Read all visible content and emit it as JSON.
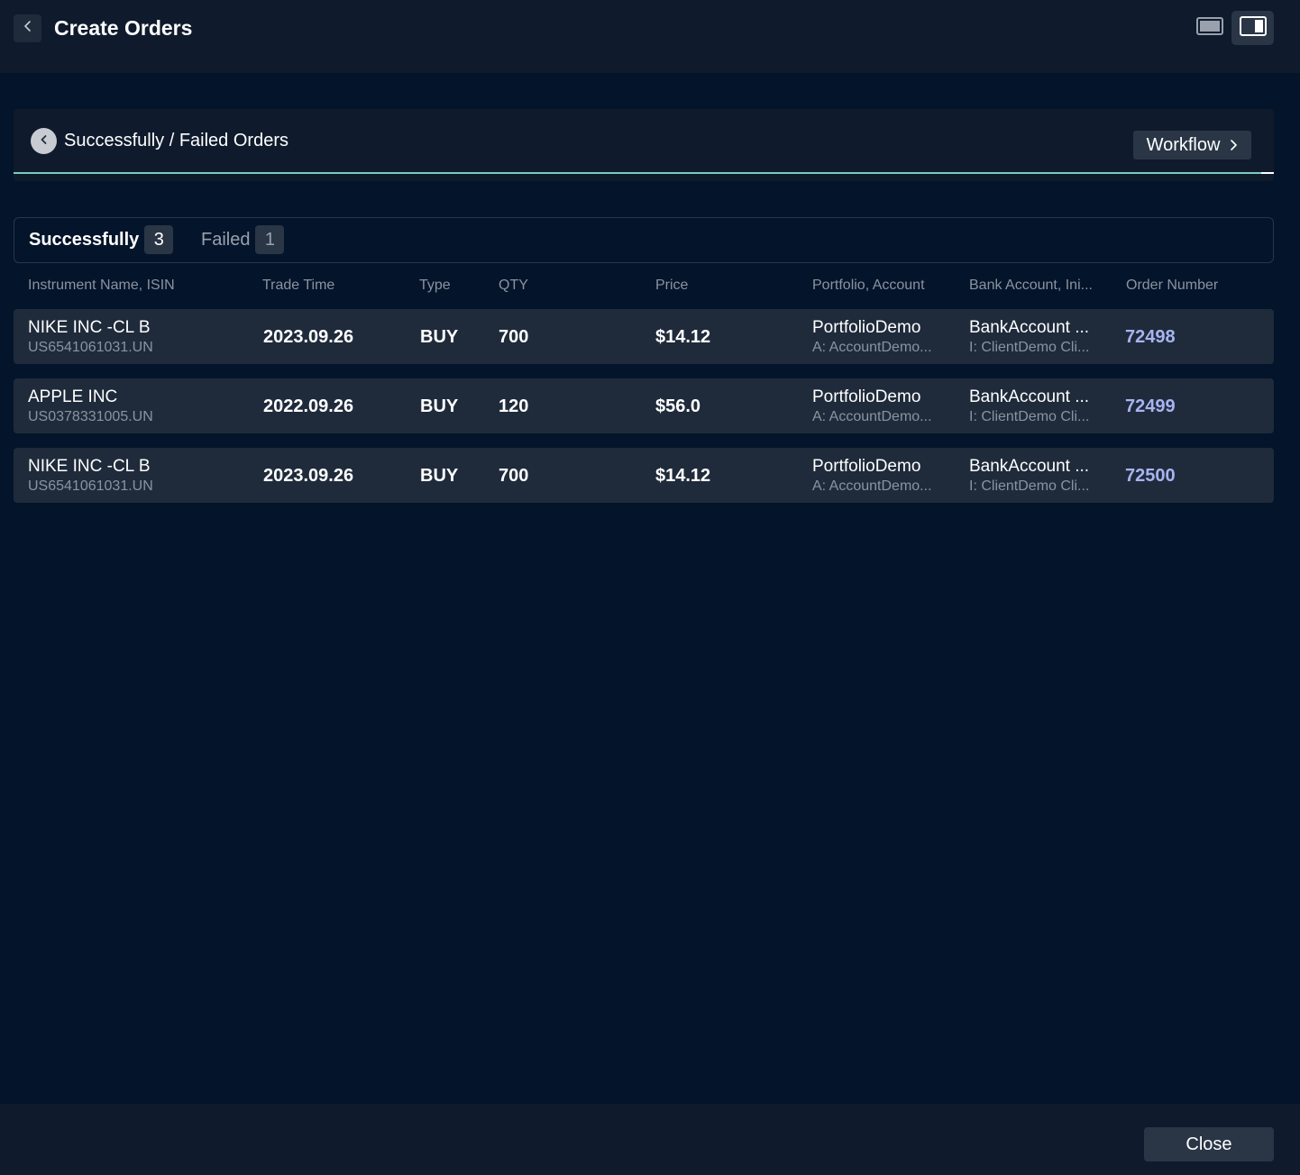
{
  "header": {
    "title": "Create Orders",
    "back_icon": "chevron-left-icon",
    "view_single_icon": "single-panel-icon",
    "view_split_icon": "split-panel-icon"
  },
  "panel": {
    "title": "Successfully / Failed Orders",
    "back_icon": "chevron-left-icon",
    "workflow_label": "Workflow",
    "workflow_icon": "chevron-right-icon",
    "progress": 0.99,
    "progress_color": "#7ecbc0"
  },
  "tabs": [
    {
      "label": "Successfully",
      "count": "3",
      "active": true
    },
    {
      "label": "Failed",
      "count": "1",
      "active": false
    }
  ],
  "table": {
    "columns": [
      "Instrument Name, ISIN",
      "Trade Time",
      "Type",
      "QTY",
      "Price",
      "Portfolio, Account",
      "Bank Account, Ini...",
      "Order Number"
    ],
    "rows": [
      {
        "instrument": "NIKE INC -CL B",
        "isin": "US6541061031.UN",
        "trade_time": "2023.09.26",
        "type": "BUY",
        "qty": "700",
        "price": "$14.12",
        "portfolio": "PortfolioDemo",
        "account": "A: AccountDemo...",
        "bank_account": "BankAccount ...",
        "initiator": "I: ClientDemo Cli...",
        "order_number": "72498"
      },
      {
        "instrument": "APPLE INC",
        "isin": "US0378331005.UN",
        "trade_time": "2022.09.26",
        "type": "BUY",
        "qty": "120",
        "price": "$56.0",
        "portfolio": "PortfolioDemo",
        "account": "A: AccountDemo...",
        "bank_account": "BankAccount ...",
        "initiator": "I: ClientDemo Cli...",
        "order_number": "72499"
      },
      {
        "instrument": "NIKE INC -CL B",
        "isin": "US6541061031.UN",
        "trade_time": "2023.09.26",
        "type": "BUY",
        "qty": "700",
        "price": "$14.12",
        "portfolio": "PortfolioDemo",
        "account": "A: AccountDemo...",
        "bank_account": "BankAccount ...",
        "initiator": "I: ClientDemo Cli...",
        "order_number": "72500"
      }
    ]
  },
  "footer": {
    "close_label": "Close"
  }
}
